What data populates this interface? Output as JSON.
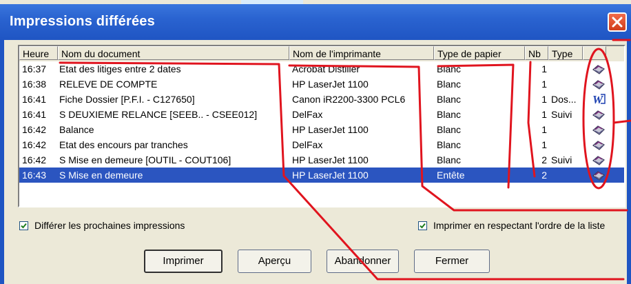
{
  "window": {
    "title": "Impressions différées",
    "close_icon": "close-icon"
  },
  "columns": [
    "Heure",
    "Nom du document",
    "Nom de l'imprimante",
    "Type de papier",
    "Nb",
    "Type",
    ""
  ],
  "rows": [
    {
      "time": "16:37",
      "doc": "Etat des litiges entre 2 dates",
      "printer": "Acrobat Distiller",
      "paper": "Blanc",
      "nb": "1",
      "type": "",
      "icon": "printer-icon",
      "selected": false
    },
    {
      "time": "16:38",
      "doc": "RELEVE DE COMPTE",
      "printer": "HP LaserJet 1100",
      "paper": "Blanc",
      "nb": "1",
      "type": "",
      "icon": "printer-icon",
      "selected": false
    },
    {
      "time": "16:41",
      "doc": "Fiche Dossier [P.F.I. - C127650]",
      "printer": "Canon iR2200-3300 PCL6",
      "paper": "Blanc",
      "nb": "1",
      "type": "Dos...",
      "icon": "word-icon",
      "selected": false
    },
    {
      "time": "16:41",
      "doc": "S DEUXIEME RELANCE [SEEB.. - CSEE012]",
      "printer": "DelFax",
      "paper": "Blanc",
      "nb": "1",
      "type": "Suivi",
      "icon": "printer-icon",
      "selected": false
    },
    {
      "time": "16:42",
      "doc": "Balance",
      "printer": "HP LaserJet 1100",
      "paper": "Blanc",
      "nb": "1",
      "type": "",
      "icon": "printer-icon",
      "selected": false
    },
    {
      "time": "16:42",
      "doc": "Etat des encours par tranches",
      "printer": "DelFax",
      "paper": "Blanc",
      "nb": "1",
      "type": "",
      "icon": "printer-icon",
      "selected": false
    },
    {
      "time": "16:42",
      "doc": "S Mise en demeure [OUTIL - COUT106]",
      "printer": "HP LaserJet 1100",
      "paper": "Blanc",
      "nb": "2",
      "type": "Suivi",
      "icon": "printer-icon",
      "selected": false
    },
    {
      "time": "16:43",
      "doc": "S Mise en demeure",
      "printer": "HP LaserJet 1100",
      "paper": "Entête",
      "nb": "2",
      "type": "",
      "icon": "printer-icon",
      "selected": true
    }
  ],
  "options": {
    "defer_label": "Différer les prochaines impressions",
    "defer_checked": true,
    "order_label": "Imprimer en respectant l'ordre de la liste",
    "order_checked": true
  },
  "buttons": {
    "print": "Imprimer",
    "preview": "Aperçu",
    "abandon": "Abandonner",
    "close": "Fermer"
  },
  "colors": {
    "title_bar": "#2a63d0",
    "selection": "#2b55c0",
    "annotation": "#e0141e"
  }
}
